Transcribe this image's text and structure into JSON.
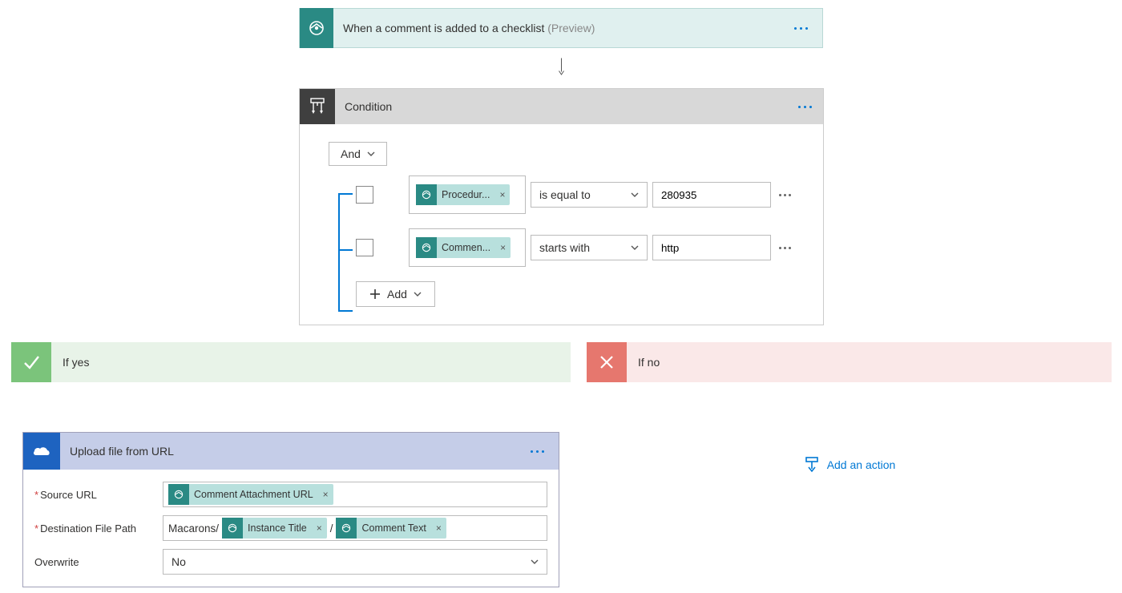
{
  "trigger": {
    "title": "When a comment is added to a checklist",
    "suffix": "(Preview)"
  },
  "condition": {
    "title": "Condition",
    "logic": "And",
    "addLabel": "Add",
    "rows": [
      {
        "token": "Procedur...",
        "operator": "is equal to",
        "value": "280935"
      },
      {
        "token": "Commen...",
        "operator": "starts with",
        "value": "http"
      }
    ]
  },
  "branches": {
    "yes": {
      "title": "If yes"
    },
    "no": {
      "title": "If no",
      "addAction": "Add an action"
    }
  },
  "action": {
    "title": "Upload file from URL",
    "fields": {
      "sourceUrl": {
        "label": "Source URL",
        "token": "Comment Attachment URL"
      },
      "destPath": {
        "label": "Destination File Path",
        "prefix": "Macarons/",
        "token1": "Instance Title",
        "sep": "/",
        "token2": "Comment Text"
      },
      "overwrite": {
        "label": "Overwrite",
        "value": "No"
      }
    }
  }
}
